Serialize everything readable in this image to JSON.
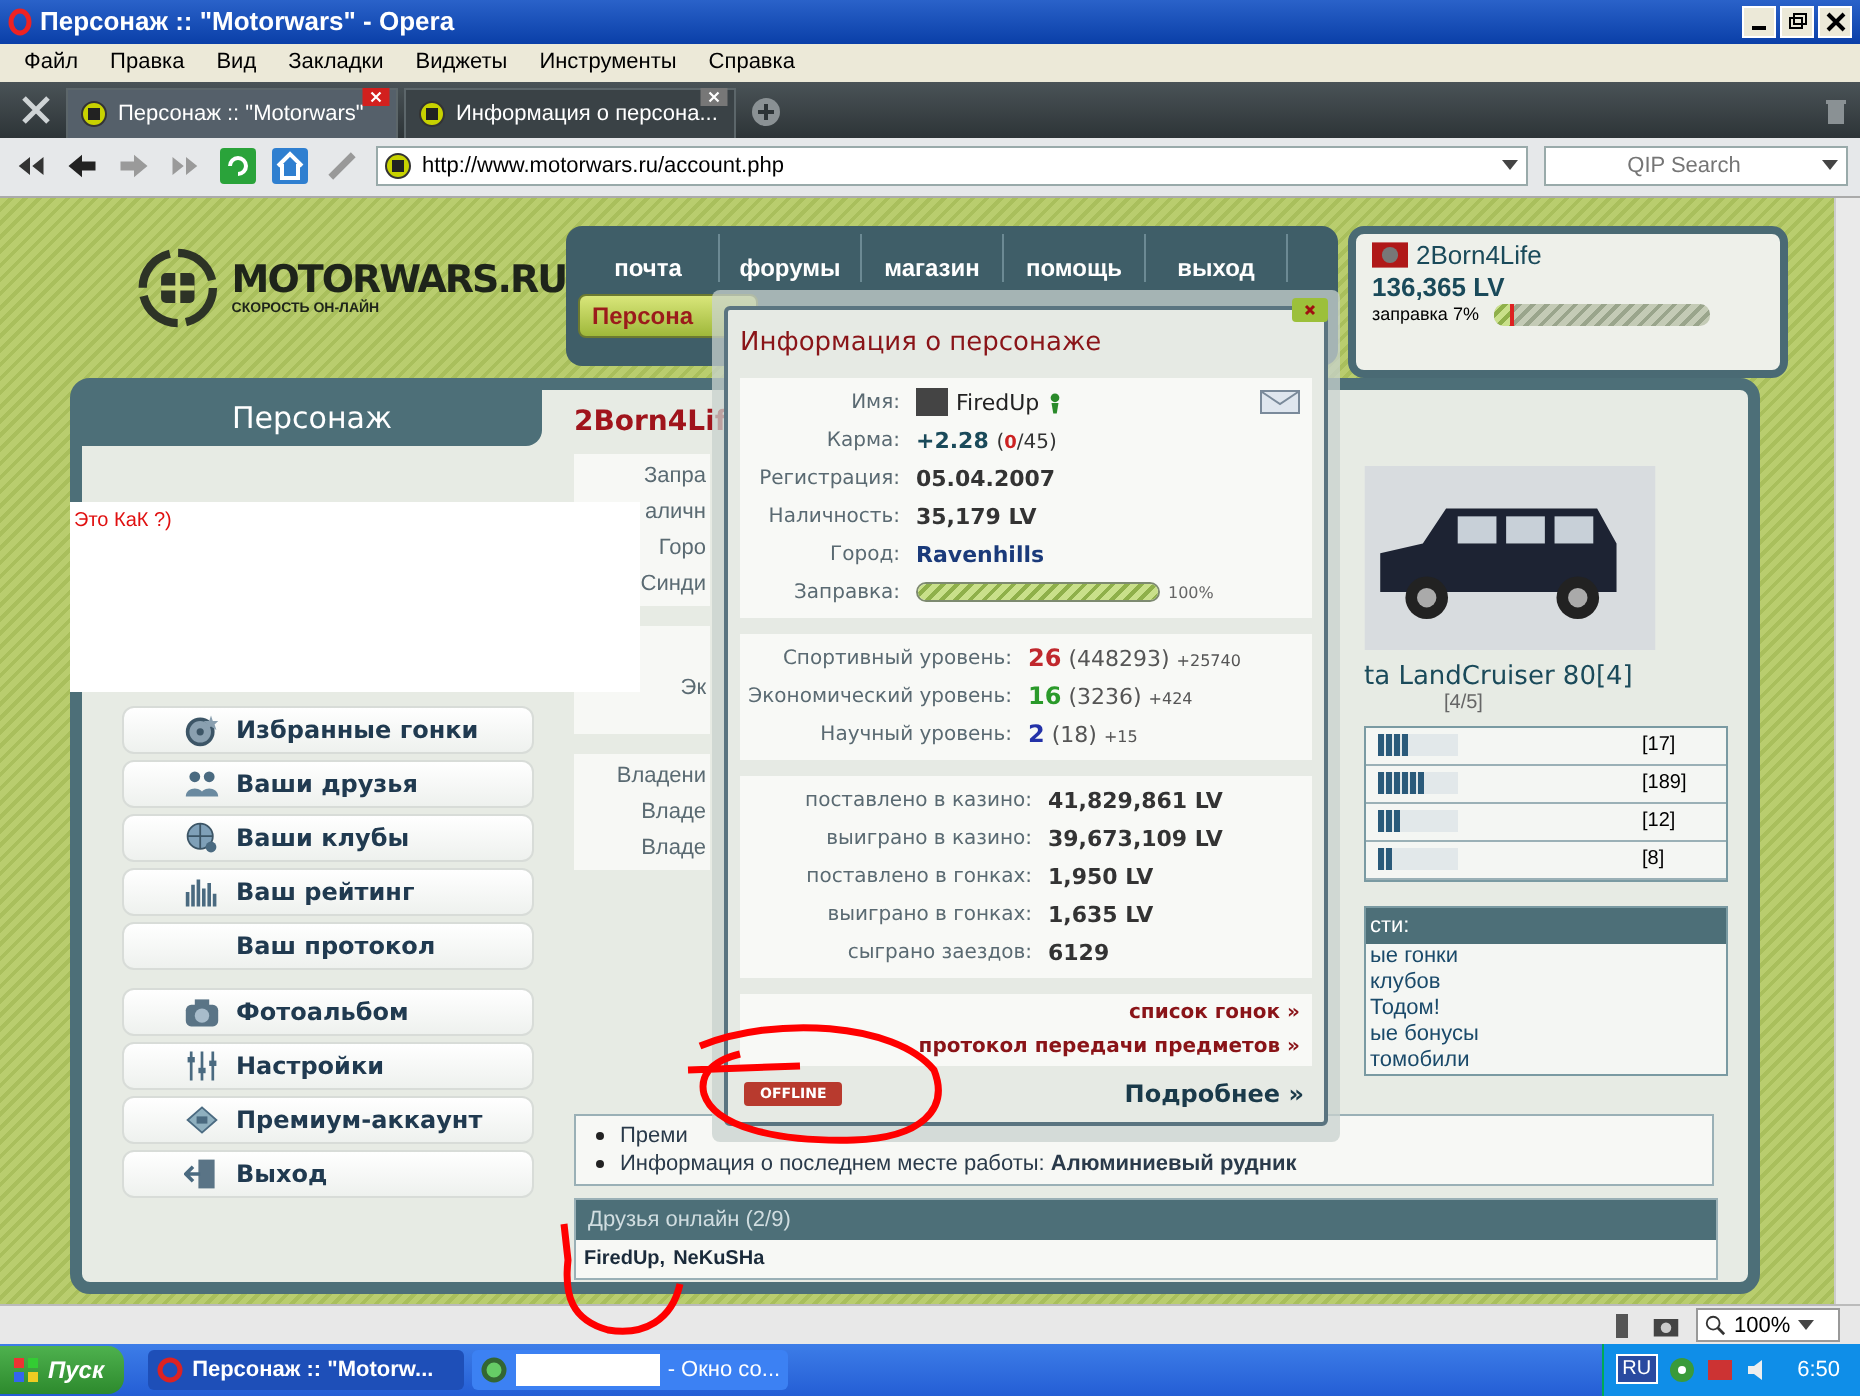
{
  "window": {
    "title": "Персонаж :: \"Motorwars\" - Opera"
  },
  "menu": [
    "Файл",
    "Правка",
    "Вид",
    "Закладки",
    "Виджеты",
    "Инструменты",
    "Справка"
  ],
  "tabs": [
    {
      "label": "Персонаж :: \"Motorwars\"",
      "selected": true
    },
    {
      "label": "Информация о персона...",
      "selected": false
    }
  ],
  "address_bar": {
    "url": "http://www.motorwars.ru/account.php"
  },
  "search": {
    "placeholder": "QIP Search"
  },
  "site": {
    "logo": "MOTORWARS.RU",
    "tagline": "СКОРОСТЬ ОН-ЛАЙН",
    "nav": [
      "почта",
      "форумы",
      "магазин",
      "помощь",
      "выход"
    ],
    "section_button": "Персона"
  },
  "user": {
    "name": "2Born4Life",
    "money": "136,365 LV",
    "fuel_label": "заправка 7%",
    "level": 0.07
  },
  "sidebar": {
    "title": "Персонаж",
    "items": [
      {
        "label": "Избранные гонки",
        "kind": "races"
      },
      {
        "label": "Ваши друзья",
        "kind": "friends"
      },
      {
        "label": "Ваши клубы",
        "kind": "clubs"
      },
      {
        "label": "Ваш рейтинг",
        "kind": "rating"
      },
      {
        "label": "Ваш протокол",
        "kind": "log"
      },
      {
        "label": "Фотоальбом",
        "kind": "album"
      },
      {
        "label": "Настройки",
        "kind": "settings"
      },
      {
        "label": "Премиум-аккаунт",
        "kind": "premium"
      },
      {
        "label": "Выход",
        "kind": "logout"
      }
    ]
  },
  "overlay_note": "Это КаК ?)",
  "profile": {
    "name": "2Born4Lif",
    "fields": [
      "Запра",
      "аличн",
      "Горо",
      "Синди"
    ],
    "economy_label": "Эк",
    "ownership": [
      "Владени",
      "Владе",
      "Владе"
    ]
  },
  "car": {
    "name": "ta LandCruiser 80[4]",
    "grade": "[4/5]",
    "stats": [
      {
        "level": 0.4,
        "value": "[17]"
      },
      {
        "level": 0.6,
        "value": "[189]"
      },
      {
        "level": 0.3,
        "value": "[12]"
      },
      {
        "level": 0.2,
        "value": "[8]"
      }
    ]
  },
  "features": {
    "title": "сти:",
    "items": [
      "ые гонки",
      "клубов",
      "Тодом!",
      "ые бонусы",
      "томобили"
    ]
  },
  "notes": [
    "Преми",
    "Информация о последнем месте работы: **Алюминиевый рудник**"
  ],
  "friends_online": {
    "title": "Друзья онлайн (2/9)",
    "names": [
      "FiredUp,",
      "NeKuSHa"
    ]
  },
  "popup": {
    "title": "Информация о персонаже",
    "rows": [
      {
        "kind": "name",
        "label": "Имя:",
        "value": "FiredUp"
      },
      {
        "kind": "karma",
        "label": "Карма:",
        "value": "+2.28",
        "open": "(",
        "count": "0",
        "rest": "/45)"
      },
      {
        "kind": "text",
        "label": "Регистрация:",
        "value": "05.04.2007"
      },
      {
        "kind": "text",
        "label": "Наличность:",
        "value": "35,179 LV"
      },
      {
        "kind": "city",
        "label": "Город:",
        "value": "Ravenhills"
      },
      {
        "kind": "fuel",
        "label": "Заправка:",
        "level": 1.0,
        "value": "100%"
      }
    ],
    "levels": [
      {
        "label": "Спортивный уровень:",
        "value": "26",
        "points": "(448293)",
        "gain": "+25740",
        "color": "#c0282d"
      },
      {
        "label": "Экономический уровень:",
        "value": "16",
        "points": "(3236)",
        "gain": "+424",
        "color": "#2a9a2a"
      },
      {
        "label": "Научный уровень:",
        "value": "2",
        "points": "(18)",
        "gain": "+15",
        "color": "#2432a8"
      }
    ],
    "stats": [
      {
        "label": "поставлено в казино:",
        "value": "41,829,861 LV"
      },
      {
        "label": "выиграно в казино:",
        "value": "39,673,109 LV"
      },
      {
        "label": "поставлено в гонках:",
        "value": "1,950 LV"
      },
      {
        "label": "выиграно в гонках:",
        "value": "1,635 LV"
      },
      {
        "label": "сыграно заездов:",
        "value": "6129"
      }
    ],
    "links": [
      "список гонок »",
      "протокол передачи предметов »"
    ],
    "status_badge": "OFFLINE",
    "more_link": "Подробнее »"
  },
  "status_bar": {
    "zoom": "100%"
  },
  "taskbar": {
    "start": "Пуск",
    "tasks": [
      {
        "label": "Персонаж :: \"Motorw...",
        "selected": true,
        "redacted": false
      },
      {
        "label": "- Окно со...",
        "selected": false,
        "redacted": true
      }
    ],
    "language": "RU",
    "time": "6:50"
  }
}
